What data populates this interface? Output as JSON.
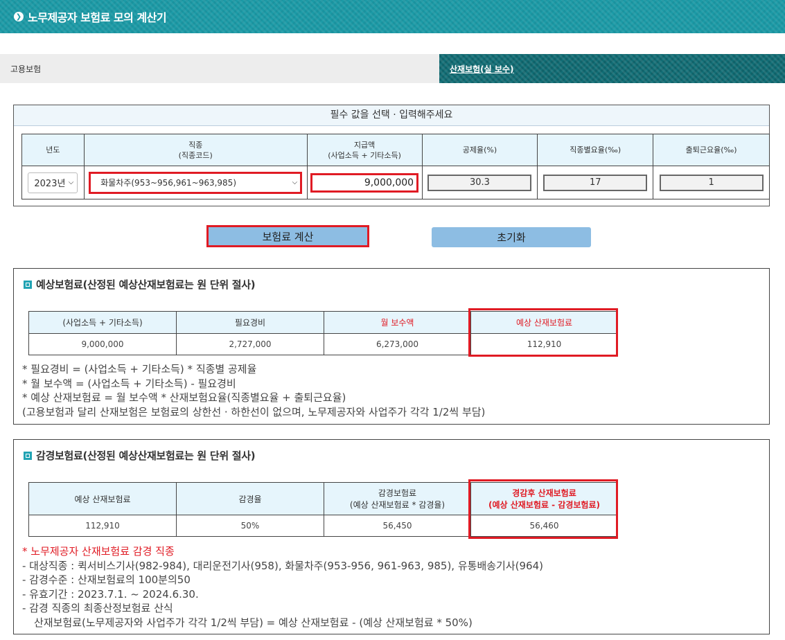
{
  "header": {
    "title": "노무제공자 보험료 모의 계산기",
    "icon": "circle-arrow-icon"
  },
  "tabs": [
    {
      "label": "고용보험",
      "active": false
    },
    {
      "label": "산재보험(실 보수)",
      "active": true
    }
  ],
  "required": {
    "title": "필수 값을 선택 · 입력해주세요",
    "headers": {
      "year": "년도",
      "job_line1": "직종",
      "job_line2": "(직종코드)",
      "amount_line1": "지급액",
      "amount_line2": "(사업소득 + 기타소득)",
      "deduction": "공제율(%)",
      "job_rate": "직종별요율(‰)",
      "commute_rate": "출퇴근요율(‰)"
    },
    "year_value": "2023년",
    "job_value": "화물차주(953~956,961~963,985)",
    "amount_value": "9,000,000",
    "deduction_value": "30.3",
    "job_rate_value": "17",
    "commute_rate_value": "1"
  },
  "buttons": {
    "calculate": "보험료 계산",
    "reset": "초기화"
  },
  "expected": {
    "title": "예상보험료(산정된 예상산재보험료는 원 단위 절사)",
    "headers": [
      "(사업소득 + 기타소득)",
      "필요경비",
      "월 보수액",
      "예상 산재보험료"
    ],
    "values": [
      "9,000,000",
      "2,727,000",
      "6,273,000",
      "112,910"
    ],
    "notes": [
      "* 필요경비 = (사업소득 + 기타소득) * 직종별 공제율",
      "* 월 보수액 = (사업소득 + 기타소득) - 필요경비",
      "* 예상 산재보험료 = 월 보수액 * 산재보험요율(직종별요율 + 출퇴근요율)",
      "(고용보험과 달리 산재보험은 보험료의 상한선 · 하한선이 없으며, 노무제공자와 사업주가 각각 1/2씩 부담)"
    ]
  },
  "reduced": {
    "title": "감경보험료(산정된 예상산재보험료는 원 단위 절사)",
    "headers": [
      {
        "l1": "예상 산재보험료",
        "l2": ""
      },
      {
        "l1": "감경율",
        "l2": ""
      },
      {
        "l1": "감경보험료",
        "l2": "(예상 산재보험료 * 감경율)"
      },
      {
        "l1": "경감후 산재보험료",
        "l2": "(예상 산재보험료 - 감경보험료)"
      }
    ],
    "values": [
      "112,910",
      "50%",
      "56,450",
      "56,460"
    ],
    "note_title": "* 노무제공자 산재보험료 감경 직종",
    "notes": [
      "- 대상직종 : 퀵서비스기사(982-984), 대리운전기사(958), 화물차주(953-956, 961-963, 985), 유통배송기사(964)",
      "- 감경수준 : 산재보험료의 100분의50",
      "- 유효기간 : 2023.7.1. ~ 2024.6.30.",
      "- 감경 직종의 최종산정보험료 산식",
      "산재보험료(노무제공자와 사업주가 각각 1/2씩 부담) = 예상 산재보험료 - (예상 산재보험료 * 50%)"
    ]
  },
  "colors": {
    "header_bg": "#1b9aa6",
    "tab_active_bg": "#116d75",
    "highlight": "#e01b24",
    "button_bg": "#8dbde3",
    "table_header_bg": "#e6f5fc"
  }
}
